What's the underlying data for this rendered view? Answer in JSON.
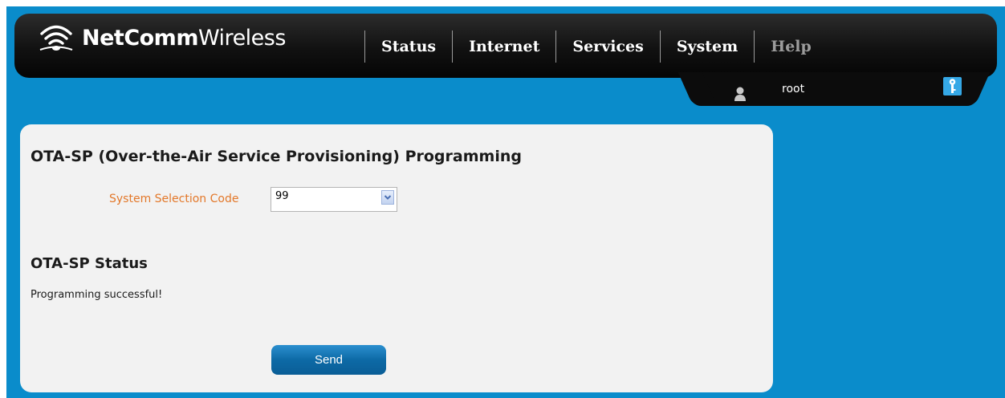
{
  "brand": {
    "name_bold": "NetComm",
    "name_light": "Wireless"
  },
  "nav": {
    "items": [
      {
        "label": "Status"
      },
      {
        "label": "Internet"
      },
      {
        "label": "Services"
      },
      {
        "label": "System"
      },
      {
        "label": "Help"
      }
    ]
  },
  "user": {
    "name": "root",
    "icon": "user-icon",
    "logout_icon": "key-icon"
  },
  "page": {
    "title": "OTA-SP (Over-the-Air Service Provisioning) Programming",
    "field": {
      "label": "System Selection Code",
      "value": "99"
    },
    "status_heading": "OTA-SP Status",
    "status_message": "Programming successful!",
    "send_label": "Send"
  },
  "colors": {
    "background": "#0a8ccb",
    "field_label": "#e3782a",
    "button": "#0d6aa6"
  }
}
